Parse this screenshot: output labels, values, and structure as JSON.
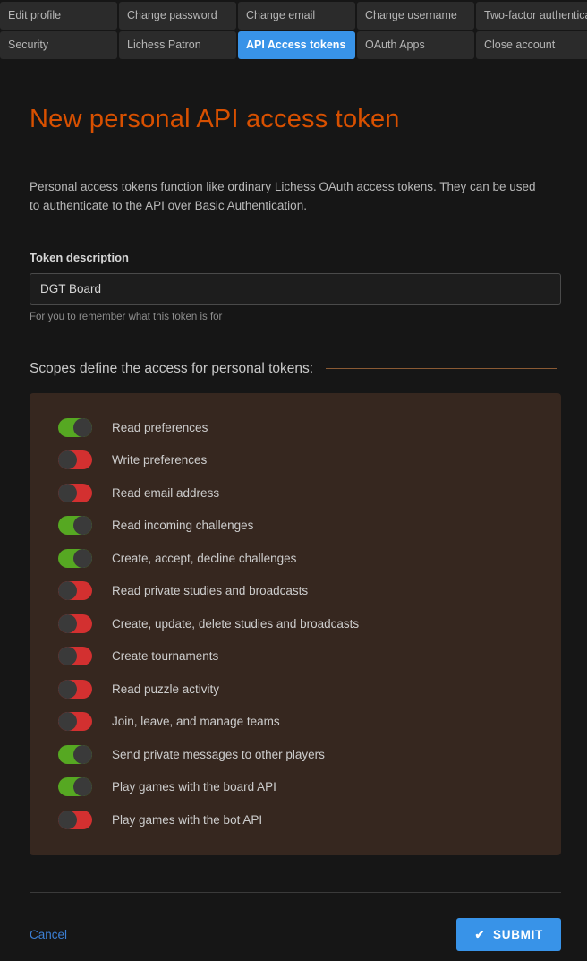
{
  "nav": {
    "rows": [
      [
        {
          "label": "Edit profile",
          "active": false
        },
        {
          "label": "Change password",
          "active": false
        },
        {
          "label": "Change email",
          "active": false
        },
        {
          "label": "Change username",
          "active": false
        },
        {
          "label": "Two-factor authentication",
          "active": false
        }
      ],
      [
        {
          "label": "Security",
          "active": false
        },
        {
          "label": "Lichess Patron",
          "active": false
        },
        {
          "label": "API Access tokens",
          "active": true
        },
        {
          "label": "OAuth Apps",
          "active": false
        },
        {
          "label": "Close account",
          "active": false
        }
      ]
    ]
  },
  "page": {
    "title": "New personal API access token",
    "intro": "Personal access tokens function like ordinary Lichess OAuth access tokens. They can be used to authenticate to the API over Basic Authentication."
  },
  "form": {
    "description_label": "Token description",
    "description_value": "DGT Board",
    "description_placeholder": "",
    "description_help": "For you to remember what this token is for"
  },
  "scopes": {
    "header": "Scopes define the access for personal tokens:",
    "items": [
      {
        "label": "Read preferences",
        "enabled": true
      },
      {
        "label": "Write preferences",
        "enabled": false
      },
      {
        "label": "Read email address",
        "enabled": false
      },
      {
        "label": "Read incoming challenges",
        "enabled": true
      },
      {
        "label": "Create, accept, decline challenges",
        "enabled": true
      },
      {
        "label": "Read private studies and broadcasts",
        "enabled": false
      },
      {
        "label": "Create, update, delete studies and broadcasts",
        "enabled": false
      },
      {
        "label": "Create tournaments",
        "enabled": false
      },
      {
        "label": "Read puzzle activity",
        "enabled": false
      },
      {
        "label": "Join, leave, and manage teams",
        "enabled": false
      },
      {
        "label": "Send private messages to other players",
        "enabled": true
      },
      {
        "label": "Play games with the board API",
        "enabled": true
      },
      {
        "label": "Play games with the bot API",
        "enabled": false
      }
    ]
  },
  "footer": {
    "cancel_label": "Cancel",
    "submit_label": "SUBMIT",
    "submit_icon": "check-icon",
    "submit_icon_glyph": "✔"
  },
  "colors": {
    "accent_orange": "#d85000",
    "accent_blue": "#3893e8",
    "toggle_on": "#56a822",
    "toggle_off": "#d33030",
    "panel_bg": "#36271f",
    "page_bg": "#161616"
  }
}
